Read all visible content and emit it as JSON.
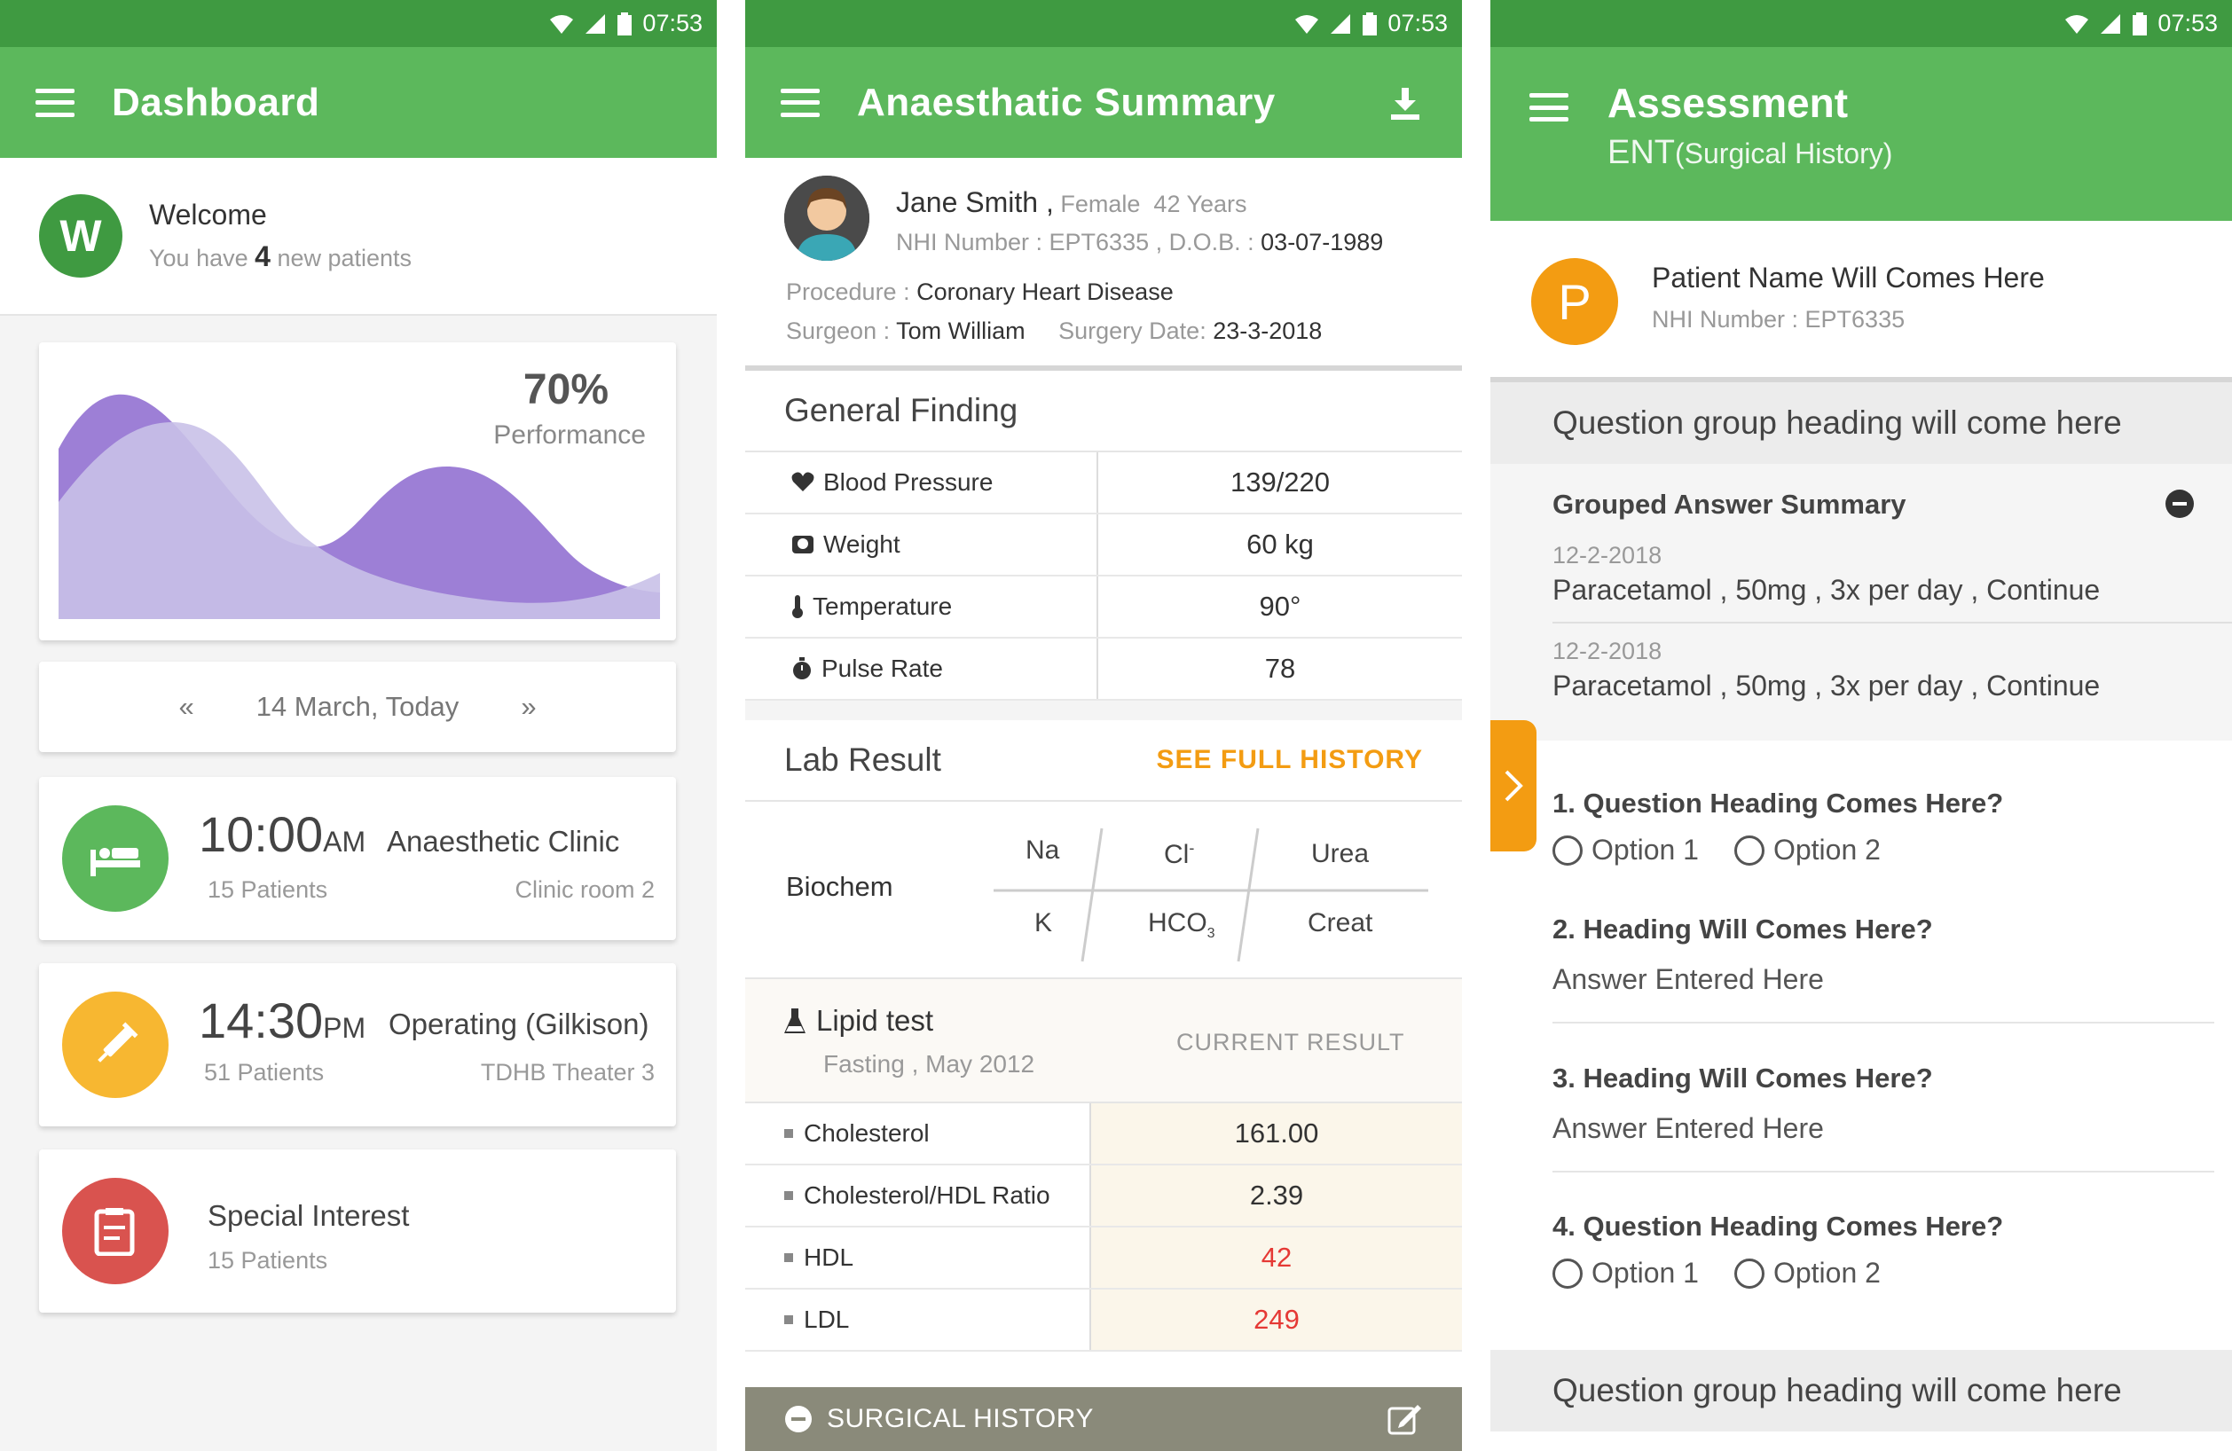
{
  "status": {
    "time": "07:53"
  },
  "dashboard": {
    "title": "Dashboard",
    "welcome_title": "Welcome",
    "welcome_prefix": "You have",
    "welcome_count": "4",
    "welcome_suffix": "new patients",
    "perf_value": "70%",
    "perf_label": "Performance",
    "date_label": "14 March, Today",
    "prev": "«",
    "next": "»",
    "appts": [
      {
        "time": "10:00",
        "ampm": "AM",
        "name": "Anaesthetic Clinic",
        "patients": "15 Patients",
        "room": "Clinic room 2",
        "color": "#5cb85c",
        "icon": "bed-icon"
      },
      {
        "time": "14:30",
        "ampm": "PM",
        "name": "Operating (Gilkison)",
        "patients": "51 Patients",
        "room": "TDHB Theater 3",
        "color": "#f7b731",
        "icon": "syringe-icon"
      }
    ],
    "special": {
      "name": "Special Interest",
      "patients": "15 Patients",
      "color": "#d9534f",
      "icon": "clipboard-icon"
    }
  },
  "summary": {
    "title": "Anaesthatic Summary",
    "patient_name": "Jane Smith ,",
    "gender": "Female",
    "age": "42 Years",
    "nhi_label": "NHI Number : EPT6335 , D.O.B. :",
    "dob": "03-07-1989",
    "procedure_label": "Procedure :",
    "procedure": "Coronary Heart Disease",
    "surgeon_label": "Surgeon :",
    "surgeon": "Tom William",
    "surgery_date_label": "Surgery Date:",
    "surgery_date": "23-3-2018",
    "general_finding": "General Finding",
    "findings": [
      {
        "label": "Blood Pressure",
        "value": "139/220",
        "icon": "heart-icon"
      },
      {
        "label": "Weight",
        "value": "60 kg",
        "icon": "scale-icon"
      },
      {
        "label": "Temperature",
        "value": "90°",
        "icon": "thermometer-icon"
      },
      {
        "label": "Pulse Rate",
        "value": "78",
        "icon": "stopwatch-icon"
      }
    ],
    "lab_result": "Lab Result",
    "see_full_history": "SEE FULL HISTORY",
    "biochem": "Biochem",
    "biochem_cells": {
      "na": "Na",
      "cl": "Cl",
      "cl_sup": "-",
      "urea": "Urea",
      "k": "K",
      "hco": "HCO",
      "hco_sub": "3",
      "creat": "Creat"
    },
    "lipid_title": "Lipid test",
    "lipid_sub": "Fasting , May 2012",
    "current_result": "CURRENT RESULT",
    "lipids": [
      {
        "label": "Cholesterol",
        "value": "161.00",
        "alert": false
      },
      {
        "label": "Cholesterol/HDL Ratio",
        "value": "2.39",
        "alert": false
      },
      {
        "label": "HDL",
        "value": "42",
        "alert": true
      },
      {
        "label": "LDL",
        "value": "249",
        "alert": true
      }
    ],
    "surgical_history": "SURGICAL HISTORY"
  },
  "assessment": {
    "title": "Assessment",
    "sub_main": "ENT",
    "sub_small": "(Surgical History)",
    "avatar": "P",
    "patient_name": "Patient Name Will Comes Here",
    "nhi": "NHI Number : EPT6335",
    "group_heading": "Question group heading will come here",
    "grouped_summary": "Grouped Answer Summary",
    "entries": [
      {
        "date": "12-2-2018",
        "text": "Paracetamol , 50mg , 3x per day , Continue"
      },
      {
        "date": "12-2-2018",
        "text": "Paracetamol , 50mg , 3x per day , Continue"
      }
    ],
    "q1": "1. Question Heading Comes Here?",
    "q2": "2. Heading Will Comes Here?",
    "q3": "3. Heading Will Comes Here?",
    "q4": "4. Question Heading Comes Here?",
    "option1": "Option 1",
    "option2": "Option 2",
    "answer": "Answer Entered Here",
    "group_heading_2": "Question group heading will come here"
  }
}
